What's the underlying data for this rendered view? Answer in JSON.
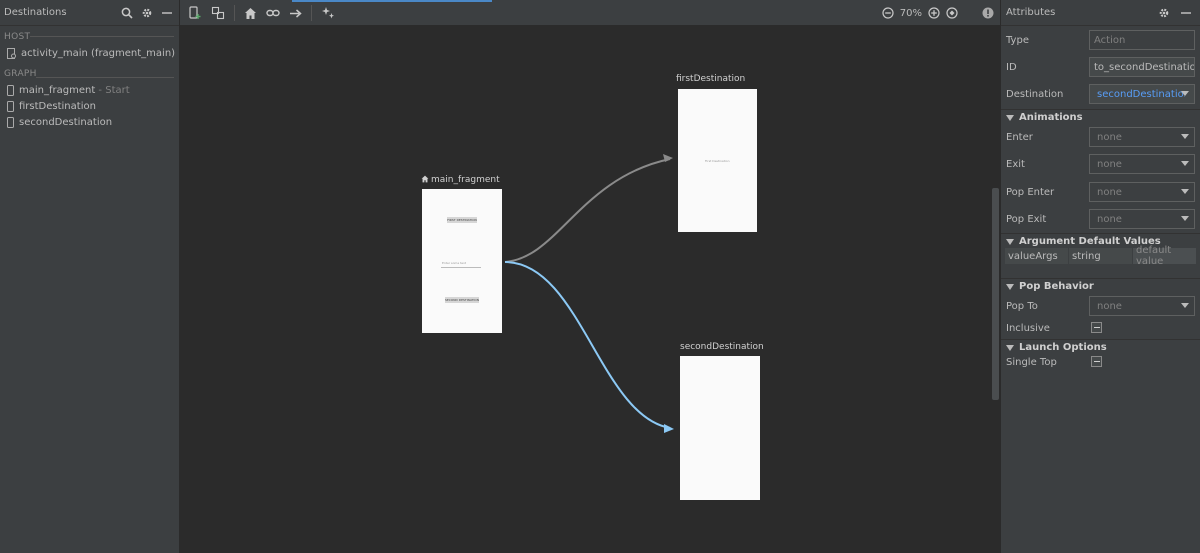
{
  "left_panel": {
    "title": "Destinations",
    "host_label": "HOST",
    "host_item": "activity_main (fragment_main)",
    "graph_label": "GRAPH",
    "graph_items": [
      {
        "name": "main_fragment",
        "suffix": " - Start"
      },
      {
        "name": "firstDestination",
        "suffix": ""
      },
      {
        "name": "secondDestination",
        "suffix": ""
      }
    ]
  },
  "toolbar": {
    "zoom_level": "70%"
  },
  "canvas": {
    "main_fragment": {
      "label": "main_fragment",
      "button1": "FIRST DESTINATION",
      "input_hint": "Enter some text",
      "button2": "SECOND DESTINATION"
    },
    "first_destination": {
      "label": "firstDestination",
      "inner_text": "First Destination"
    },
    "second_destination": {
      "label": "secondDestination"
    },
    "colors": {
      "selected_action": "#8cc9f5",
      "action": "#8a8a8a"
    }
  },
  "attributes": {
    "title": "Attributes",
    "type_label": "Type",
    "type_value": "Action",
    "id_label": "ID",
    "id_value": "to_secondDestination",
    "destination_label": "Destination",
    "destination_value": "secondDestination",
    "animations_heading": "Animations",
    "enter_label": "Enter",
    "enter_value": "none",
    "exit_label": "Exit",
    "exit_value": "none",
    "pop_enter_label": "Pop Enter",
    "pop_enter_value": "none",
    "pop_exit_label": "Pop Exit",
    "pop_exit_value": "none",
    "argument_heading": "Argument Default Values",
    "arg_name": "valueArgs",
    "arg_type": "string",
    "arg_default_placeholder": "default value",
    "pop_behavior_heading": "Pop Behavior",
    "pop_to_label": "Pop To",
    "pop_to_value": "none",
    "inclusive_label": "Inclusive",
    "launch_options_heading": "Launch Options",
    "single_top_label": "Single Top"
  }
}
